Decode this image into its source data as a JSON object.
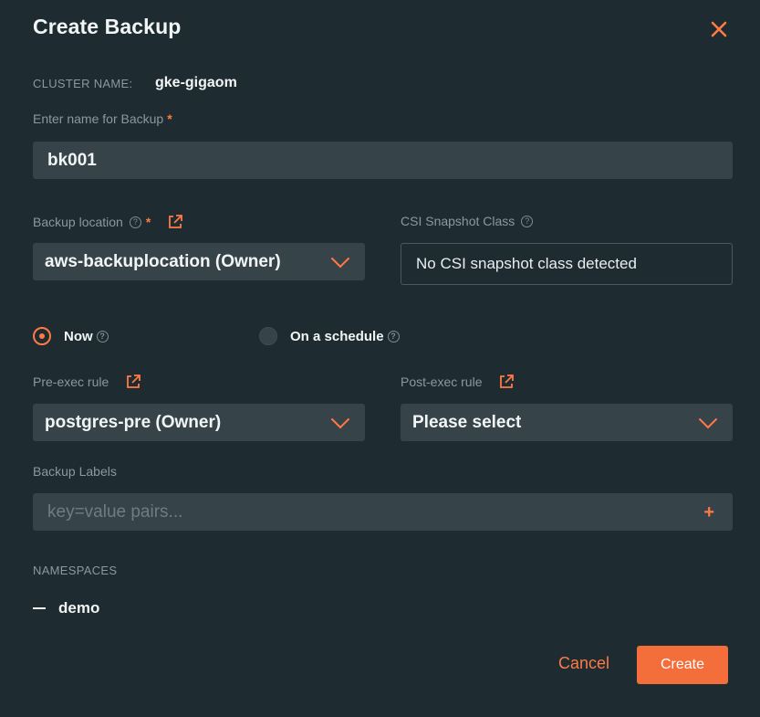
{
  "dialog": {
    "title": "Create Backup",
    "cluster_label": "CLUSTER NAME:",
    "cluster_value": "gke-gigaom"
  },
  "backup_name": {
    "label": "Enter name for Backup",
    "required_mark": "*",
    "value": "bk001"
  },
  "backup_location": {
    "label": "Backup location",
    "required_mark": "*",
    "value": "aws-backuplocation (Owner)"
  },
  "csi_snapshot": {
    "label": "CSI Snapshot Class",
    "value": "No CSI snapshot class detected"
  },
  "schedule": {
    "now_label": "Now",
    "now_selected": true,
    "schedule_label": "On a schedule",
    "schedule_selected": false
  },
  "pre_exec": {
    "label": "Pre-exec rule",
    "value": "postgres-pre (Owner)"
  },
  "post_exec": {
    "label": "Post-exec rule",
    "value": "Please select"
  },
  "labels": {
    "label": "Backup Labels",
    "placeholder": "key=value pairs...",
    "add_symbol": "+"
  },
  "namespaces": {
    "label": "NAMESPACES",
    "items": [
      "demo"
    ]
  },
  "actions": {
    "cancel_label": "Cancel",
    "create_label": "Create"
  },
  "icons": {
    "close": "close-icon",
    "help": "help-circle-icon",
    "external_link": "external-link-icon",
    "dropdown": "chevron-down-icon"
  },
  "colors": {
    "background": "#1e2b31",
    "input": "#364349",
    "accent": "#ff7a45",
    "primary_button": "#f46e3b",
    "muted_text": "#8b999f"
  }
}
